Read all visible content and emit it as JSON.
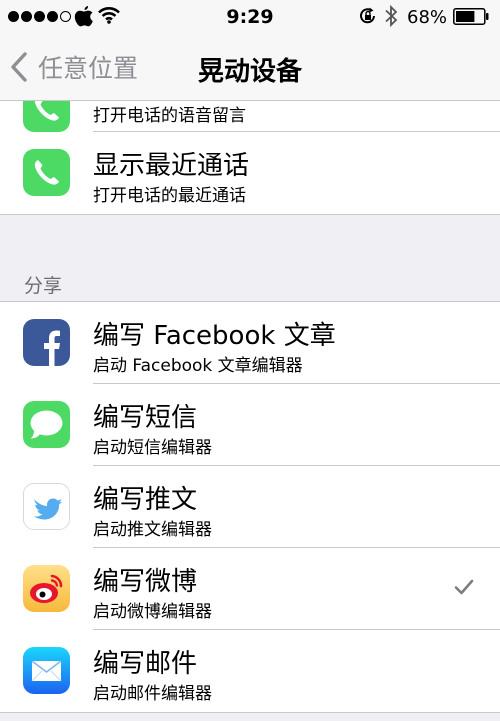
{
  "status_bar": {
    "time": "9:29",
    "battery": "68%",
    "battery_level": 0.68,
    "icons": [
      "signal-dots",
      "apple-logo",
      "wifi-icon",
      "rotation-lock-icon",
      "bluetooth-icon",
      "battery-icon"
    ]
  },
  "nav": {
    "back_label": "任意位置",
    "title": "晃动设备"
  },
  "top_group": {
    "partial_row": {
      "subtitle": "打开电话的语音留言",
      "icon": "phone-icon"
    },
    "rows": [
      {
        "title": "显示最近通话",
        "subtitle": "打开电话的最近通话",
        "icon": "phone-icon"
      }
    ]
  },
  "share_section": {
    "header": "分享",
    "rows": [
      {
        "title": "编写 Facebook 文章",
        "subtitle": "启动 Facebook 文章编辑器",
        "icon": "facebook-icon",
        "checked": false
      },
      {
        "title": "编写短信",
        "subtitle": "启动短信编辑器",
        "icon": "messages-icon",
        "checked": false
      },
      {
        "title": "编写推文",
        "subtitle": "启动推文编辑器",
        "icon": "twitter-icon",
        "checked": false
      },
      {
        "title": "编写微博",
        "subtitle": "启动微博编辑器",
        "icon": "weibo-icon",
        "checked": true
      },
      {
        "title": "编写邮件",
        "subtitle": "启动邮件编辑器",
        "icon": "mail-icon",
        "checked": false
      }
    ]
  },
  "colors": {
    "background": "#efeff4",
    "separator": "#c8c7cc",
    "secondary_text": "#8e8e93",
    "phone_green": "#4cd964",
    "facebook_blue": "#3b5998",
    "twitter_blue": "#55acee",
    "weibo_red": "#e6162d",
    "mail_blue": "#1d8cf0"
  }
}
